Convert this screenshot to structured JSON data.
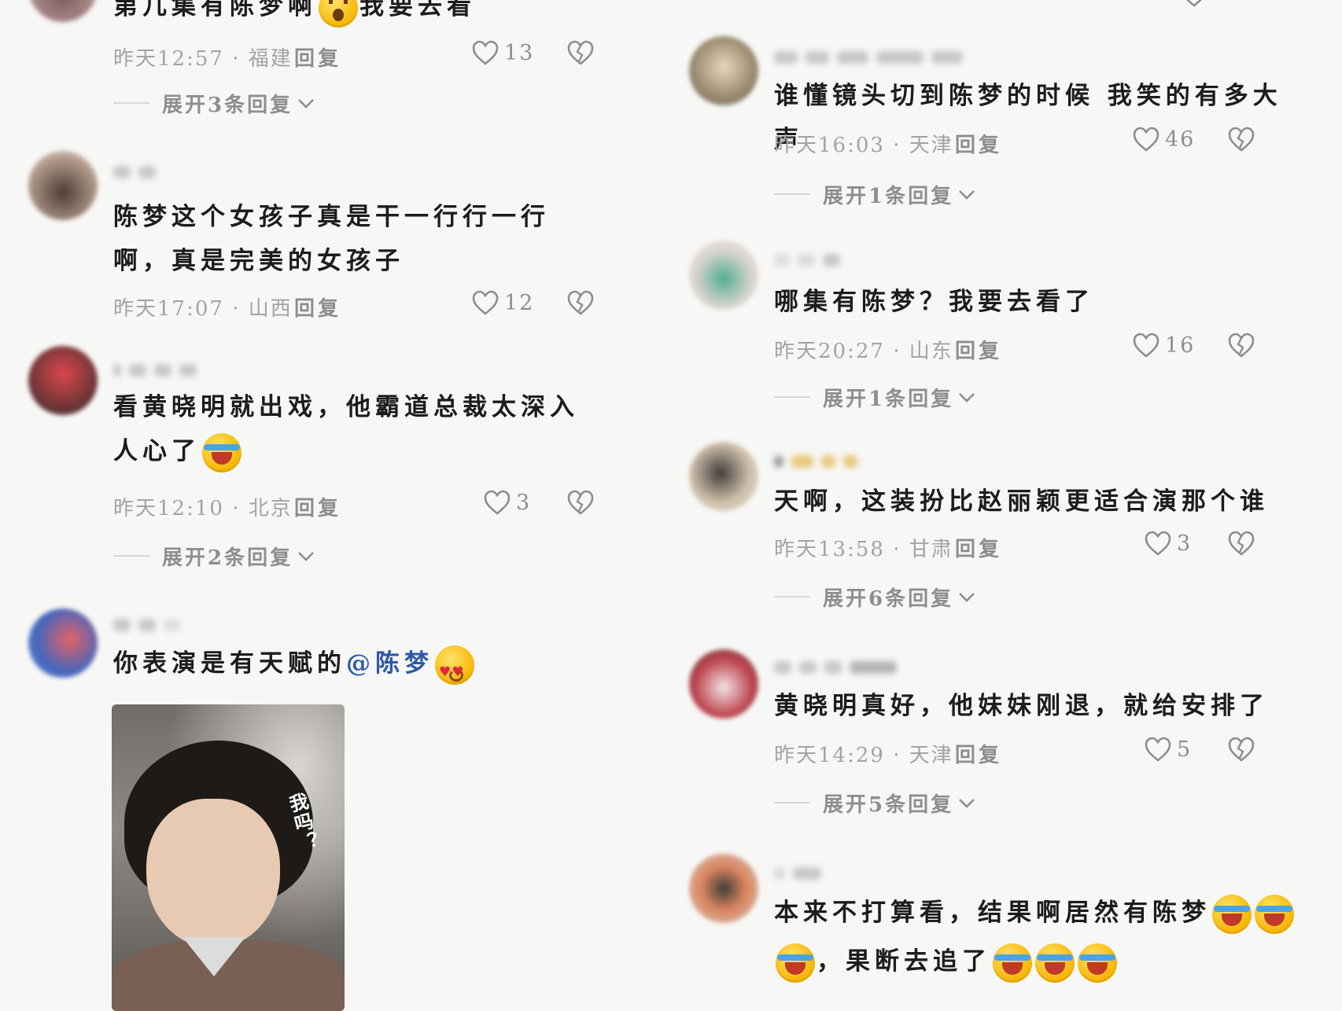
{
  "left": {
    "comments": [
      {
        "text_before": "第几集有陈梦啊",
        "text_after": "我要去看",
        "time": "昨天12:57",
        "location": "福建",
        "reply": "回复",
        "likes": "13",
        "expand": "展开3条回复"
      },
      {
        "text": "陈梦这个女孩子真是干一行行一行啊，真是完美的女孩子",
        "time": "昨天17:07",
        "location": "山西",
        "reply": "回复",
        "likes": "12"
      },
      {
        "text": "看黄晓明就出戏，他霸道总裁太深入人心了",
        "time": "昨天12:10",
        "location": "北京",
        "reply": "回复",
        "likes": "3",
        "expand": "展开2条回复"
      },
      {
        "text": "你表演是有天赋的",
        "mention": "@陈梦",
        "image_caption": "我吗？"
      }
    ]
  },
  "right": {
    "comments": [
      {
        "text": "谁懂镜头切到陈梦的时候 我笑的有多大声",
        "time": "昨天16:03",
        "location": "天津",
        "reply": "回复",
        "likes": "46",
        "expand": "展开1条回复"
      },
      {
        "text": "哪集有陈梦？我要去看了",
        "time": "昨天20:27",
        "location": "山东",
        "reply": "回复",
        "likes": "16",
        "expand": "展开1条回复"
      },
      {
        "text": "天啊，这装扮比赵丽颖更适合演那个谁",
        "time": "昨天13:58",
        "location": "甘肃",
        "reply": "回复",
        "likes": "3",
        "expand": "展开6条回复"
      },
      {
        "text": "黄晓明真好，他妹妹刚退，就给安排了",
        "time": "昨天14:29",
        "location": "天津",
        "reply": "回复",
        "likes": "5",
        "expand": "展开5条回复"
      },
      {
        "text_line1": "本来不打算看，结果啊居然有陈梦",
        "text_line2": "，果断去追了"
      }
    ]
  },
  "meta_separator": " · ",
  "icons": {
    "like": "heart-outline-icon",
    "dislike": "broken-heart-icon",
    "expand": "chevron-down-icon",
    "emoji_laugh": "laughing-crying-emoji-icon",
    "emoji_shock": "shocked-emoji-icon",
    "emoji_love": "heart-eyes-kiss-emoji-icon"
  },
  "colors": {
    "background": "#f7f7f5",
    "text": "#1c1c1c",
    "meta": "#a3a3a3",
    "mention": "#2d5aa8"
  }
}
